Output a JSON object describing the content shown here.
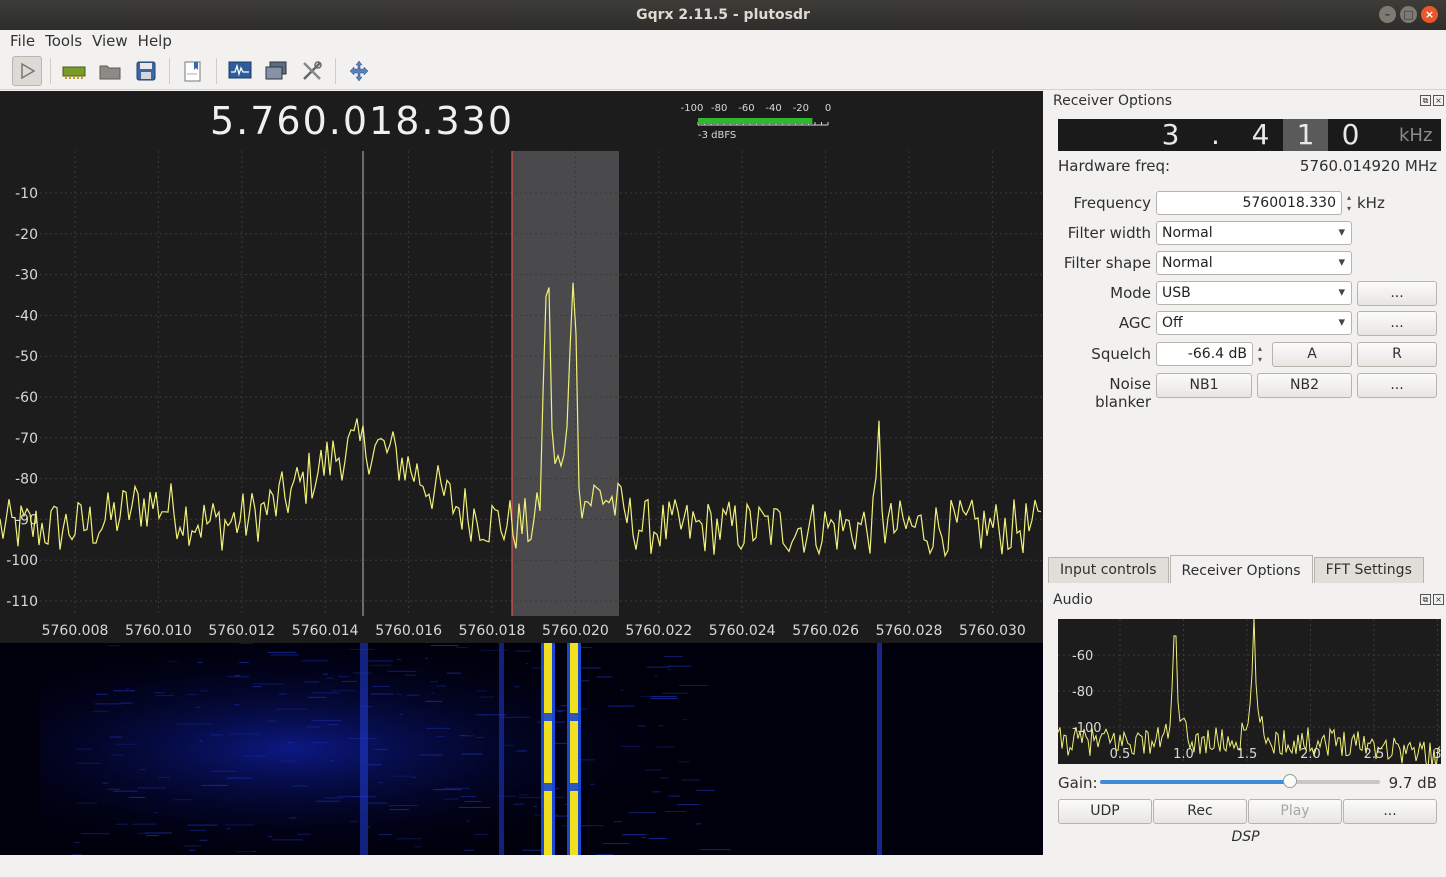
{
  "window": {
    "title": "Gqrx 2.11.5 - plutosdr",
    "buttons": [
      "–",
      "□",
      "×"
    ]
  },
  "menu": [
    "File",
    "Tools",
    "View",
    "Help"
  ],
  "toolbar_icons": [
    "play-icon",
    "hardware-icon",
    "open-icon",
    "save-icon",
    "bookmark-icon",
    "fft-icon",
    "remote-icon",
    "tools-icon",
    "fullscreen-icon"
  ],
  "main": {
    "frequency_display": "5.760.018.330",
    "meter": {
      "ticks": [
        "-100",
        "-80",
        "-60",
        "-40",
        "-20",
        "0"
      ],
      "label": "-3 dBFS",
      "level_fraction": 0.88
    },
    "y_ticks": [
      "-10",
      "-20",
      "-30",
      "-40",
      "-50",
      "-60",
      "-70",
      "-80",
      "-90",
      "-100",
      "-110"
    ],
    "x_ticks": [
      "5760.008",
      "5760.010",
      "5760.012",
      "5760.014",
      "5760.016",
      "5760.018",
      "5760.020",
      "5760.022",
      "5760.024",
      "5760.026",
      "5760.028",
      "5760.030"
    ]
  },
  "receiver": {
    "title": "Receiver Options",
    "offset_digits": [
      "3",
      ".",
      "4",
      "1",
      "0"
    ],
    "offset_selected": 3,
    "offset_unit": "kHz",
    "hw_label": "Hardware freq:",
    "hw_value": "5760.014920 MHz",
    "frequency_label": "Frequency",
    "frequency_value": "5760018.330",
    "frequency_unit": "kHz",
    "filter_width_label": "Filter width",
    "filter_width_value": "Normal",
    "filter_shape_label": "Filter shape",
    "filter_shape_value": "Normal",
    "mode_label": "Mode",
    "mode_value": "USB",
    "agc_label": "AGC",
    "agc_value": "Off",
    "squelch_label": "Squelch",
    "squelch_value": "-66.4 dB",
    "noise_label": "Noise blanker",
    "nb1": "NB1",
    "nb2": "NB2",
    "dots": "...",
    "a_btn": "A",
    "r_btn": "R"
  },
  "tabs": [
    "Input controls",
    "Receiver Options",
    "FFT Settings"
  ],
  "active_tab": 1,
  "audio": {
    "title": "Audio",
    "y_ticks": [
      "-60",
      "-80",
      "-100"
    ],
    "x_ticks": [
      "0.5",
      "1.0",
      "1.5",
      "2.0",
      "2.5",
      "3"
    ],
    "gain_label": "Gain:",
    "gain_value": "9.7 dB",
    "gain_fraction": 0.68,
    "udp": "UDP",
    "rec": "Rec",
    "play": "Play",
    "more": "...",
    "dsp": "DSP"
  }
}
